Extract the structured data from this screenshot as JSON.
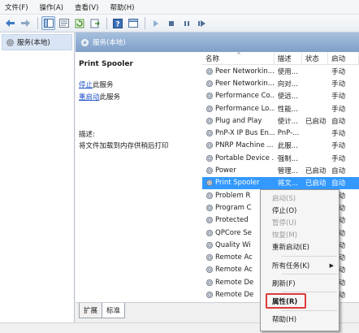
{
  "menubar": {
    "items": [
      "文件(F)",
      "操作(A)",
      "查看(V)",
      "帮助(H)"
    ]
  },
  "toolbar": {
    "icons": [
      "back-arrow-icon",
      "forward-arrow-icon",
      "show-hide-tree-icon",
      "properties-icon",
      "refresh-icon",
      "export-icon",
      "help-icon",
      "toggle-pane-icon",
      "play-icon",
      "stop-icon",
      "pause-icon",
      "restart-icon"
    ]
  },
  "tree": {
    "node_label": "服务(本地)"
  },
  "header": {
    "title": "服务(本地)"
  },
  "description": {
    "service_name": "Print Spooler",
    "stop_link": "停止",
    "stop_suffix": "此服务",
    "restart_link": "重启动",
    "restart_suffix": "此服务",
    "desc_label": "描述:",
    "desc_text": "将文件加载到内存供稍后打印"
  },
  "list": {
    "columns": [
      "名称",
      "描述",
      "状态",
      "启动"
    ],
    "rows": [
      {
        "name": "Peer Networkin...",
        "desc": "使用...",
        "status": "",
        "startup": "手动"
      },
      {
        "name": "Peer Networkin...",
        "desc": "向对...",
        "status": "",
        "startup": "手动"
      },
      {
        "name": "Performance Co...",
        "desc": "使远...",
        "status": "",
        "startup": "手动"
      },
      {
        "name": "Performance Lo...",
        "desc": "性能...",
        "status": "",
        "startup": "手动"
      },
      {
        "name": "Plug and Play",
        "desc": "使计...",
        "status": "已启动",
        "startup": "自动"
      },
      {
        "name": "PnP-X IP Bus En...",
        "desc": "PnP-...",
        "status": "",
        "startup": "手动"
      },
      {
        "name": "PNRP Machine ...",
        "desc": "此服...",
        "status": "",
        "startup": "手动"
      },
      {
        "name": "Portable Device ...",
        "desc": "强制...",
        "status": "",
        "startup": "手动"
      },
      {
        "name": "Power",
        "desc": "管理...",
        "status": "已启动",
        "startup": "自动"
      },
      {
        "name": "Print Spooler",
        "desc": "将文...",
        "status": "已启动",
        "startup": "自动"
      },
      {
        "name": "Problem R",
        "desc": "",
        "status": "",
        "startup": "手动"
      },
      {
        "name": "Program C",
        "desc": "",
        "status": "",
        "startup": "手动"
      },
      {
        "name": "Protected",
        "desc": "",
        "status": "",
        "startup": "手动"
      },
      {
        "name": "QPCore Se",
        "desc": "",
        "status": "",
        "startup": "自动"
      },
      {
        "name": "Quality Wi",
        "desc": "",
        "status": "",
        "startup": "手动"
      },
      {
        "name": "Remote Ac",
        "desc": "",
        "status": "",
        "startup": "手动"
      },
      {
        "name": "Remote Ac",
        "desc": "",
        "status": "",
        "startup": "手动"
      },
      {
        "name": "Remote De",
        "desc": "",
        "status": "",
        "startup": "手动"
      },
      {
        "name": "Remote De",
        "desc": "",
        "status": "",
        "startup": "手动"
      }
    ]
  },
  "tabs": [
    "扩展",
    "标准"
  ],
  "context_menu": {
    "start": "启动(S)",
    "stop": "停止(O)",
    "pause": "暂停(U)",
    "resume": "恢复(M)",
    "restart": "重新启动(E)",
    "all_tasks": "所有任务(K)",
    "refresh": "刷新(F)",
    "properties": "属性(R)",
    "help": "帮助(H)"
  },
  "colors": {
    "selection": "#3399ff",
    "header_gradient": "#8eaed6",
    "link": "#1c52c8",
    "highlight_box": "#e03a3a"
  }
}
